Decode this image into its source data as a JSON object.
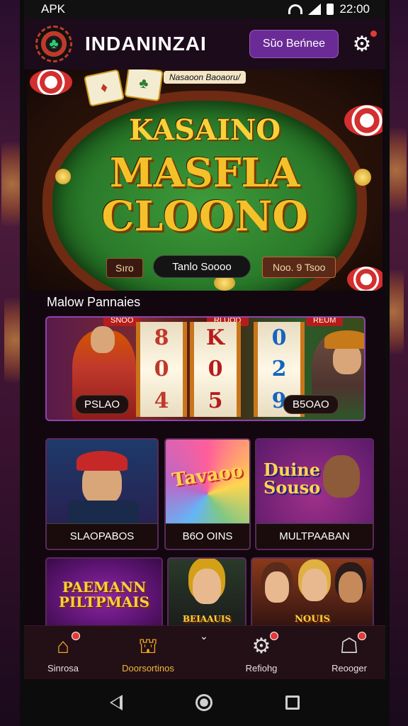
{
  "status_bar": {
    "left_label": "APK",
    "time": "22:00"
  },
  "header": {
    "title": "INDANINZAI",
    "action_button": "Sŭo Beńnee"
  },
  "hero": {
    "top_caption": "Nasaoon Baoaoru/",
    "title_line1": "KASAINO",
    "title_line2": "MASFLA",
    "title_line3": "CLOONO",
    "chip_left": "Sıro",
    "pill": "Tanlo Soooo",
    "chip_right": "Noo. 9 Tsoo"
  },
  "section_label": "Malow Pannaies",
  "slot_banner": {
    "tabs": [
      "SNOO",
      "RLUOD",
      "REUM"
    ],
    "reel1": [
      "8",
      "0",
      "4"
    ],
    "reel2": [
      "K",
      "0",
      "5"
    ],
    "reel3": [
      "0",
      "2",
      "9"
    ],
    "button_left": "PSLAO",
    "button_right": "B5OAO"
  },
  "games": [
    {
      "label": "SLAOPABOS",
      "art_title": ""
    },
    {
      "label": "B6O OINS",
      "art_title": "Tavaoo"
    },
    {
      "label": "MULTPAABAN",
      "art_title": "Duine Souso"
    },
    {
      "label": "",
      "art_title": "PAEMANN PILTPMAIS"
    },
    {
      "label": "",
      "art_title": "BEIAAUIS"
    },
    {
      "label": "",
      "art_title": "NOUIS"
    }
  ],
  "bottom_nav": [
    {
      "label": "Sinrosa",
      "icon": "home-icon",
      "active": false
    },
    {
      "label": "Doorsortinos",
      "icon": "house-roof-icon",
      "active": true
    },
    {
      "label": "Refiohg",
      "icon": "gear-icon",
      "active": false
    },
    {
      "label": "Reooger",
      "icon": "profile-icon",
      "active": false
    }
  ],
  "colors": {
    "accent": "#6a2b96",
    "active_nav": "#f5a623",
    "badge": "#e53935"
  }
}
